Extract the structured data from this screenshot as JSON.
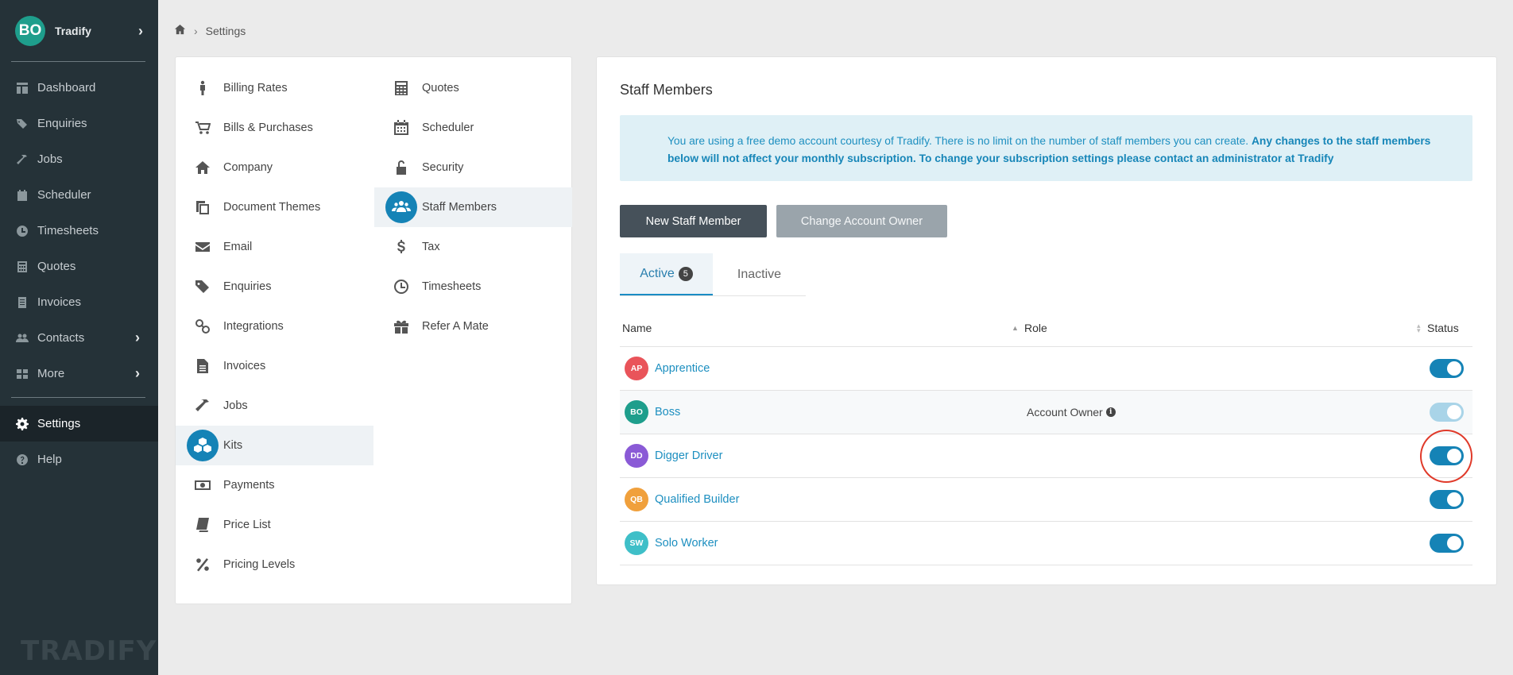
{
  "sidebar": {
    "brand": {
      "initials": "BO",
      "name": "Tradify"
    },
    "items": [
      {
        "label": "Dashboard",
        "icon": "dashboard-icon"
      },
      {
        "label": "Enquiries",
        "icon": "tags-icon"
      },
      {
        "label": "Jobs",
        "icon": "hammer-icon"
      },
      {
        "label": "Scheduler",
        "icon": "calendar-icon"
      },
      {
        "label": "Timesheets",
        "icon": "clock-icon"
      },
      {
        "label": "Quotes",
        "icon": "calculator-icon"
      },
      {
        "label": "Invoices",
        "icon": "invoice-icon"
      },
      {
        "label": "Contacts",
        "icon": "users-icon"
      },
      {
        "label": "More",
        "icon": "grid-icon"
      }
    ],
    "bottom_items": [
      {
        "label": "Settings",
        "icon": "gear-icon"
      },
      {
        "label": "Help",
        "icon": "help-icon"
      }
    ],
    "logo": "TRADIFY"
  },
  "breadcrumb": {
    "current": "Settings"
  },
  "settings_menu": {
    "col1": [
      "Billing Rates",
      "Bills & Purchases",
      "Company",
      "Document Themes",
      "Email",
      "Enquiries",
      "Integrations",
      "Invoices",
      "Jobs",
      "Kits",
      "Payments",
      "Price List",
      "Pricing Levels"
    ],
    "col2": [
      "Quotes",
      "Scheduler",
      "Security",
      "Staff Members",
      "Tax",
      "Timesheets",
      "Refer A Mate"
    ]
  },
  "main": {
    "title": "Staff Members",
    "info": {
      "text": "You are using a free demo account courtesy of Tradify. There is no limit on the number of staff members you can create. ",
      "bold": "Any changes to the staff members below will not affect your monthly subscription. To change your subscription settings please contact an administrator at Tradify"
    },
    "buttons": {
      "new_staff": "New Staff Member",
      "change_owner": "Change Account Owner"
    },
    "tabs": {
      "active": "Active",
      "active_count": "5",
      "inactive": "Inactive"
    },
    "table": {
      "headers": {
        "name": "Name",
        "role": "Role",
        "status": "Status"
      },
      "rows": [
        {
          "initials": "AP",
          "name": "Apprentice",
          "role": "",
          "color": "#e9545a",
          "enabled": true
        },
        {
          "initials": "BO",
          "name": "Boss",
          "role": "Account Owner",
          "color": "#1e9e8c",
          "enabled": true
        },
        {
          "initials": "DD",
          "name": "Digger Driver",
          "role": "",
          "color": "#8a5ad6",
          "enabled": true
        },
        {
          "initials": "QB",
          "name": "Qualified Builder",
          "role": "",
          "color": "#f0a03c",
          "enabled": true
        },
        {
          "initials": "SW",
          "name": "Solo Worker",
          "role": "",
          "color": "#3fbfc8",
          "enabled": true
        }
      ]
    }
  },
  "colors": {
    "sidebar": "#253238",
    "accent": "#1583b6",
    "link": "#1d8fc0",
    "highlight": "#e03a2a"
  }
}
